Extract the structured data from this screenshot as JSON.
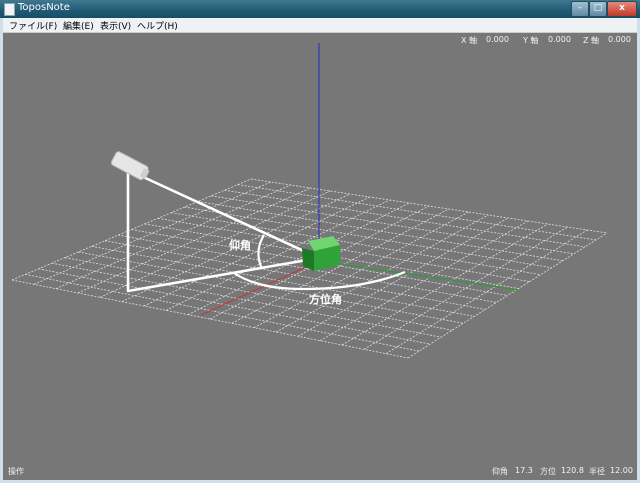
{
  "window": {
    "title": "ToposNote",
    "min_glyph": "–",
    "max_glyph": "□",
    "close_glyph": "x"
  },
  "menu": [
    {
      "label": "ファイル(F)"
    },
    {
      "label": "編集(E)"
    },
    {
      "label": "表示(V)"
    },
    {
      "label": "ヘルプ(H)"
    }
  ],
  "axis_readout": {
    "x": {
      "label": "X 軸",
      "value": "0.000"
    },
    "y": {
      "label": "Y 軸",
      "value": "0.000"
    },
    "z": {
      "label": "Z 軸",
      "value": "0.000"
    }
  },
  "scene": {
    "elevation_label": "仰角",
    "azimuth_label": "方位角",
    "colors": {
      "background": "#777777",
      "grid": "#f2f2f2",
      "x_axis": "#c23a3a",
      "y_axis": "#2f9a3a",
      "z_axis": "#2a2ac8",
      "cube": "#2fa33a",
      "lines": "#ffffff"
    }
  },
  "status": {
    "mode": "操作",
    "elevation": {
      "label": "仰角",
      "value": "17.3"
    },
    "azimuth": {
      "label": "方位",
      "value": "120.8"
    },
    "radius": {
      "label": "半径",
      "value": "12.00"
    }
  }
}
